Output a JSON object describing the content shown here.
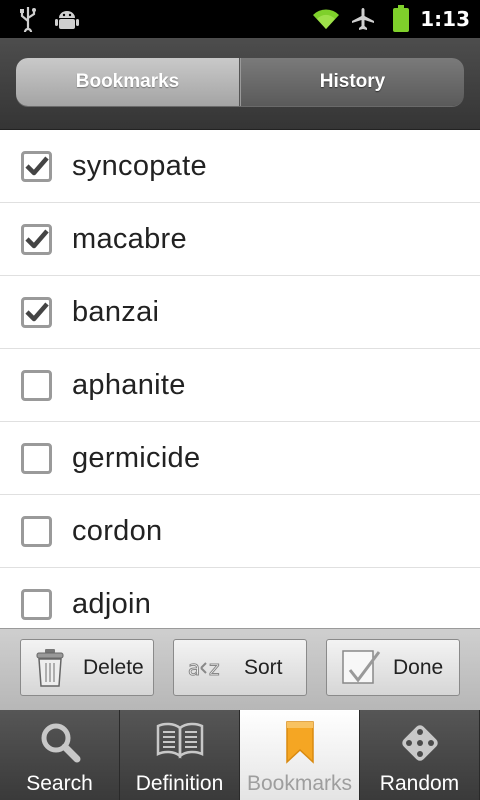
{
  "status_bar": {
    "time": "1:13",
    "icons": [
      "usb-icon",
      "android-debug-icon",
      "wifi-icon",
      "airplane-icon",
      "battery-icon"
    ],
    "accent_color": "#7fd02b"
  },
  "segmented_tabs": [
    {
      "label": "Bookmarks",
      "selected": true
    },
    {
      "label": "History",
      "selected": false
    }
  ],
  "bookmarks": [
    {
      "word": "syncopate",
      "checked": true
    },
    {
      "word": "macabre",
      "checked": true
    },
    {
      "word": "banzai",
      "checked": true
    },
    {
      "word": "aphanite",
      "checked": false
    },
    {
      "word": "germicide",
      "checked": false
    },
    {
      "word": "cordon",
      "checked": false
    },
    {
      "word": "adjoin",
      "checked": false
    }
  ],
  "actions": {
    "delete_label": "Delete",
    "sort_label": "Sort",
    "done_label": "Done"
  },
  "bottom_tabs": [
    {
      "label": "Search",
      "icon": "search-icon",
      "selected": false
    },
    {
      "label": "Definition",
      "icon": "book-icon",
      "selected": false
    },
    {
      "label": "Bookmarks",
      "icon": "bookmark-icon",
      "selected": true
    },
    {
      "label": "Random",
      "icon": "dice-icon",
      "selected": false
    }
  ],
  "colors": {
    "bookmark_orange": "#f5a623"
  }
}
